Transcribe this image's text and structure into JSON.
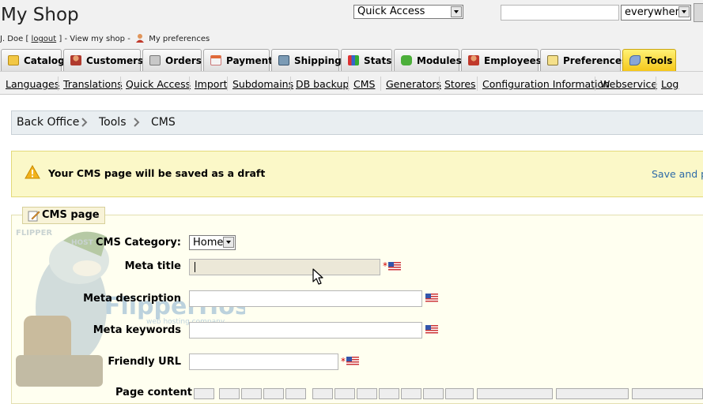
{
  "header": {
    "shop_title": "My Shop",
    "user_name": "J. Doe [",
    "logout": "logout",
    "after_logout": "] -",
    "view_shop": "View my shop",
    "dash": "-",
    "my_preferences": "My preferences",
    "quick_access": "Quick Access",
    "search_scope": "everywhere"
  },
  "tabs": [
    {
      "label": "Catalog",
      "icon": "folder-icon"
    },
    {
      "label": "Customers",
      "icon": "person-icon"
    },
    {
      "label": "Orders",
      "icon": "cart-icon"
    },
    {
      "label": "Payment",
      "icon": "payment-icon"
    },
    {
      "label": "Shipping",
      "icon": "truck-icon"
    },
    {
      "label": "Stats",
      "icon": "bar-chart-icon"
    },
    {
      "label": "Modules",
      "icon": "puzzle-icon"
    },
    {
      "label": "Employees",
      "icon": "employee-icon"
    },
    {
      "label": "Preferences",
      "icon": "preferences-icon"
    },
    {
      "label": "Tools",
      "icon": "wrench-icon",
      "active": true
    }
  ],
  "subtabs": [
    "Languages",
    "Translations",
    "Quick Access",
    "Import",
    "Subdomains",
    "DB backup",
    "CMS",
    "Generators",
    "Stores",
    "Configuration Information",
    "Webservice",
    "Log"
  ],
  "breadcrumb": [
    "Back Office",
    "Tools",
    "CMS"
  ],
  "warning": {
    "text": "Your CMS page will be saved as a draft",
    "action": "Save and pr"
  },
  "form": {
    "legend": "CMS page",
    "category_label": "CMS Category:",
    "category_value": "Home",
    "meta_title_label": "Meta title",
    "meta_description_label": "Meta description",
    "meta_keywords_label": "Meta keywords",
    "friendly_url_label": "Friendly URL",
    "page_content_label": "Page content",
    "required_mark": "*"
  },
  "watermark": {
    "brand": "FlipperHost",
    "tagline": "web hosting company"
  },
  "colors": {
    "active_tab": "#f5c71a",
    "warning_bg": "#fbf8c8",
    "link": "#2d6aa8",
    "required": "#d20000"
  }
}
